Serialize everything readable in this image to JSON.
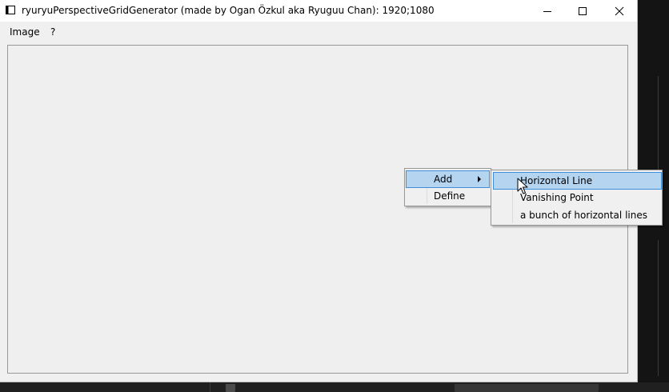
{
  "window": {
    "title": "ryuryuPerspectiveGridGenerator (made by Ogan Özkul aka Ryuguu Chan): 1920;1080",
    "controls": {
      "minimize": "minimize-icon",
      "maximize": "maximize-icon",
      "close": "close-icon"
    }
  },
  "menubar": {
    "items": [
      {
        "label": "Image"
      },
      {
        "label": "?"
      }
    ]
  },
  "context_menu": {
    "items": [
      {
        "label": "Add",
        "has_submenu": true,
        "highlighted": true
      },
      {
        "label": "Define"
      }
    ]
  },
  "submenu": {
    "items": [
      {
        "label": "Horizontal Line",
        "highlighted": true
      },
      {
        "label": "Vanishing Point"
      },
      {
        "label": "a bunch of horizontal lines"
      }
    ]
  },
  "colors": {
    "highlight_fill": "#b4d4f0",
    "highlight_border": "#3d8fdb",
    "window_bg": "#f0f0f0",
    "titlebar_bg": "#ffffff"
  }
}
